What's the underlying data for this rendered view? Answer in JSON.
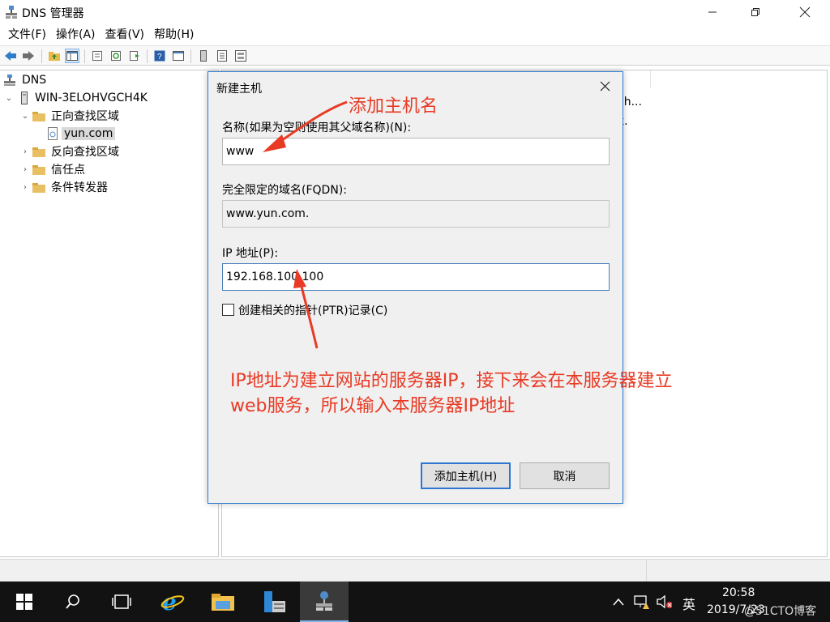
{
  "window": {
    "title": "DNS 管理器"
  },
  "menu": [
    "文件(F)",
    "操作(A)",
    "查看(V)",
    "帮助(H)"
  ],
  "toolbar_icons": [
    "back-arrow-icon",
    "forward-arrow-icon",
    "folder-up-icon",
    "show-hide-tree-icon",
    "properties-icon",
    "refresh-icon",
    "export-icon",
    "help-icon",
    "console-icon",
    "server-icon",
    "list-icon",
    "records-icon"
  ],
  "tree": {
    "root": "DNS",
    "server": "WIN-3ELOHVGCH4K",
    "forward_zones": "正向查找区域",
    "zone": "yun.com",
    "reverse_zones": "反向查找区域",
    "trust_points": "信任点",
    "conditional_forwarders": "条件转发器"
  },
  "right_pane": {
    "truncated_1": "ch...",
    "truncated_2": "k."
  },
  "dialog": {
    "title": "新建主机",
    "name_label": "名称(如果为空则使用其父域名称)(N):",
    "name_value": "www",
    "fqdn_label": "完全限定的域名(FQDN):",
    "fqdn_value": "www.yun.com.",
    "ip_label": "IP 地址(P):",
    "ip_value": "192.168.100.100",
    "ptr_label": "创建相关的指针(PTR)记录(C)",
    "ptr_checked": false,
    "add_button": "添加主机(H)",
    "cancel_button": "取消"
  },
  "annotations": {
    "host_name": "添加主机名",
    "ip_line1": "IP地址为建立网站的服务器IP，接下来会在本服务器建立",
    "ip_line2": "web服务，所以输入本服务器IP地址",
    "color": "#e83a24"
  },
  "taskbar": {
    "time": "20:58",
    "date": "2019/7/23",
    "ime": "英",
    "watermark": "@51CTO博客"
  }
}
